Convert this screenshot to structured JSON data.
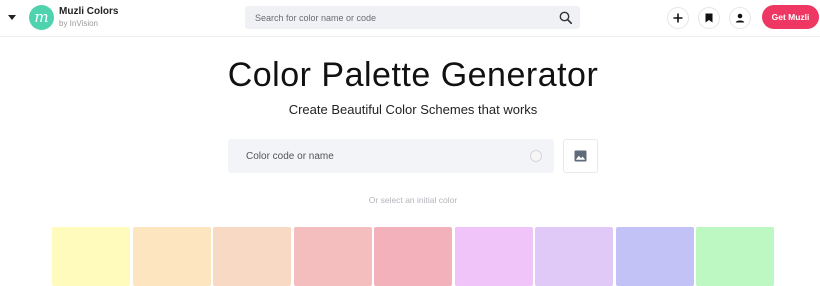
{
  "header": {
    "brand_name": "Muzli Colors",
    "brand_sub": "by InVision",
    "logo_letter": "m",
    "search_placeholder": "Search for color name or code",
    "get_button": "Get Muzli"
  },
  "main": {
    "title": "Color Palette Generator",
    "subtitle": "Create Beautiful Color Schemes that works",
    "color_input_placeholder": "Color code or name",
    "hint": "Or select an initial color"
  },
  "swatches": [
    {
      "color": "#fefbbd"
    },
    {
      "color": "#fde5c0"
    },
    {
      "color": "#f8d9c4"
    },
    {
      "color": "#f5bebe"
    },
    {
      "color": "#f3b1bb"
    },
    {
      "color": "#f0c3f9"
    },
    {
      "color": "#e0c9f7"
    },
    {
      "color": "#c2c2f7"
    },
    {
      "color": "#bdf7c1"
    }
  ],
  "colors": {
    "brand_teal": "#4fd3ae",
    "accent_pink": "#ee3762"
  },
  "icons": [
    "caret-down-icon",
    "search-icon",
    "plus-icon",
    "bookmark-icon",
    "user-icon",
    "image-icon"
  ]
}
